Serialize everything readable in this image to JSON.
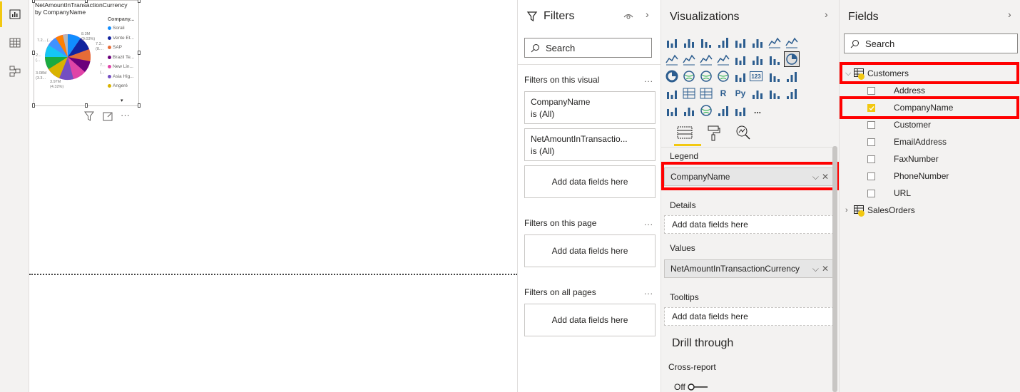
{
  "visual": {
    "title_line1": "NetAmountInTransactionCurrency",
    "title_line2": "by CompanyName",
    "legend_title": "Company...",
    "legend": [
      {
        "label": "Sorali",
        "color": "#118dff"
      },
      {
        "label": "Vente Et...",
        "color": "#12239e"
      },
      {
        "label": "SAP",
        "color": "#e66c37"
      },
      {
        "label": "Brazil Te...",
        "color": "#6b007b"
      },
      {
        "label": "New Lin...",
        "color": "#e044a7"
      },
      {
        "label": "Asia Hig...",
        "color": "#744ec2"
      },
      {
        "label": "Angeré",
        "color": "#d9b300"
      }
    ],
    "pie_labels": {
      "a": "8.3M",
      "a2": "(9.03%)",
      "b": "7.3...",
      "b2": "(8....",
      "c": "7.2... (...",
      "d": "2...",
      "d2": "(...",
      "e": "3.08M",
      "e2": "(3.3...",
      "f": "3.97M",
      "f2": "(4.32%)",
      "g": "7...",
      "h": "(..."
    }
  },
  "filters": {
    "title": "Filters",
    "search_placeholder": "Search",
    "on_visual_label": "Filters on this visual",
    "more": "...",
    "cards": [
      {
        "line1": "CompanyName",
        "line2": "is (All)"
      },
      {
        "line1": "NetAmountInTransactio...",
        "line2": "is (All)"
      }
    ],
    "add_fields": "Add data fields here",
    "on_page_label": "Filters on this page",
    "on_all_pages_label": "Filters on all pages"
  },
  "visualizations": {
    "title": "Visualizations",
    "more_visuals": "...",
    "legend_label": "Legend",
    "legend_value": "CompanyName",
    "details_label": "Details",
    "details_placeholder": "Add data fields here",
    "values_label": "Values",
    "values_value": "NetAmountInTransactionCurrency",
    "tooltips_label": "Tooltips",
    "tooltips_placeholder": "Add data fields here",
    "drill_through": "Drill through",
    "cross_report": "Cross-report",
    "cross_report_toggle": "Off",
    "icon_text_r": "R",
    "icon_text_py": "Py",
    "icon_text_123": "123"
  },
  "fields": {
    "title": "Fields",
    "search_placeholder": "Search",
    "tables": [
      {
        "name": "Customers",
        "expanded": true,
        "columns": [
          {
            "name": "Address",
            "checked": false
          },
          {
            "name": "CompanyName",
            "checked": true
          },
          {
            "name": "Customer",
            "checked": false
          },
          {
            "name": "EmailAddress",
            "checked": false
          },
          {
            "name": "FaxNumber",
            "checked": false
          },
          {
            "name": "PhoneNumber",
            "checked": false
          },
          {
            "name": "URL",
            "checked": false
          }
        ]
      },
      {
        "name": "SalesOrders",
        "expanded": false,
        "columns": []
      }
    ]
  },
  "colors": {
    "accent": "#f2c811",
    "highlight": "#ff0000"
  }
}
